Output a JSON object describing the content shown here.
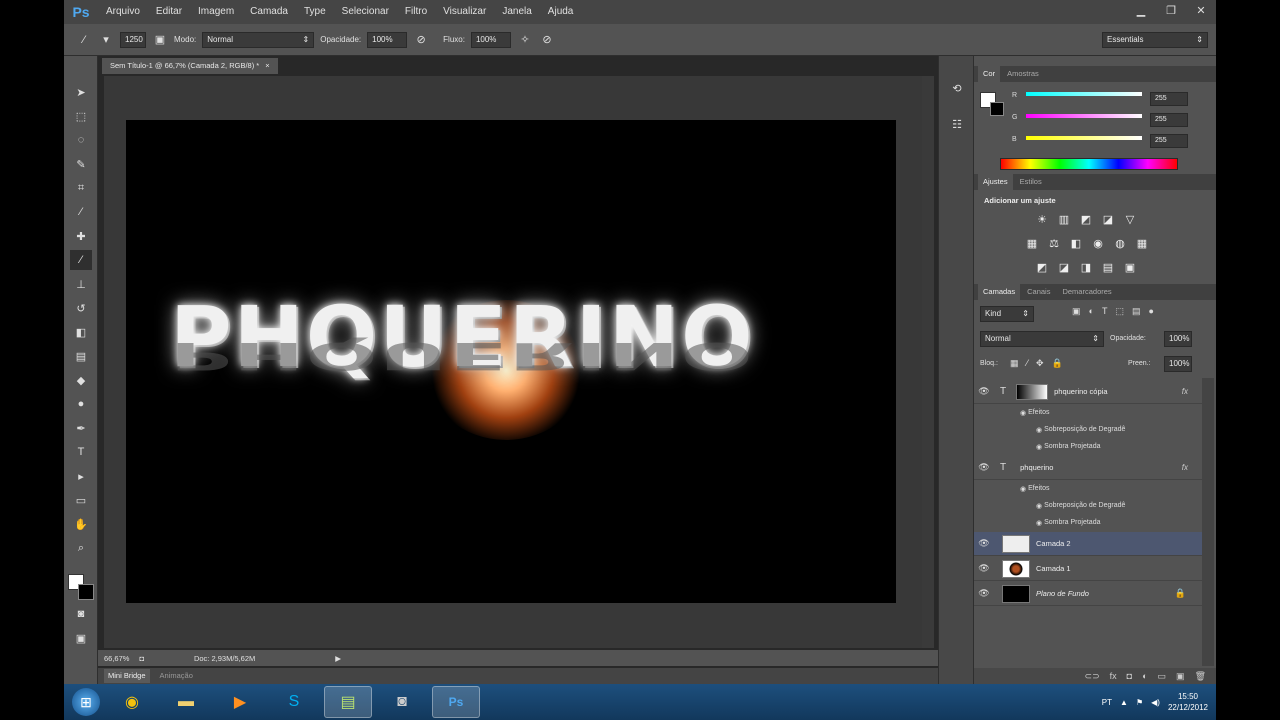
{
  "menubar": {
    "logo": "Ps",
    "items": [
      "Arquivo",
      "Editar",
      "Imagem",
      "Camada",
      "Type",
      "Selecionar",
      "Filtro",
      "Visualizar",
      "Janela",
      "Ajuda"
    ]
  },
  "options": {
    "brush_size": "1250",
    "mode_label": "Modo:",
    "mode_value": "Normal",
    "opacity_label": "Opacidade:",
    "opacity_value": "100%",
    "flow_label": "Fluxo:",
    "flow_value": "100%",
    "workspace": "Essentials"
  },
  "document": {
    "tab_title": "Sem Título-1 @ 66,7% (Camada 2, RGB/8) *",
    "logo_text": "PHQUERINO",
    "zoom": "66,67%",
    "doc_size": "Doc: 2,93M/5,62M"
  },
  "bottom_tabs": [
    "Mini Bridge",
    "Animação"
  ],
  "color_panel": {
    "tabs": [
      "Cor",
      "Amostras"
    ],
    "channels": [
      {
        "label": "R",
        "value": "255",
        "color": "#ff3030"
      },
      {
        "label": "G",
        "value": "255",
        "color": "#30ff30"
      },
      {
        "label": "B",
        "value": "255",
        "color": "#3030ff"
      }
    ]
  },
  "adjust_panel": {
    "tabs": [
      "Ajustes",
      "Estilos"
    ],
    "title": "Adicionar um ajuste"
  },
  "layers_panel": {
    "tabs": [
      "Camadas",
      "Canais",
      "Demarcadores"
    ],
    "kind": "Kind",
    "blend": "Normal",
    "opacity_label": "Opacidade:",
    "opacity_value": "100%",
    "lock_label": "Bloq.:",
    "fill_label": "Preen.:",
    "fill_value": "100%",
    "layers": [
      {
        "name": "phquerino cópia",
        "effects_label": "Efeitos",
        "effects": [
          "Sobreposição de Degradê",
          "Sombra Projetada"
        ]
      },
      {
        "name": "phquerino",
        "effects_label": "Efeitos",
        "effects": [
          "Sobreposição de Degradê",
          "Sombra Projetada"
        ]
      },
      {
        "name": "Camada 2"
      },
      {
        "name": "Camada 1"
      },
      {
        "name": "Plano de Fundo"
      }
    ]
  },
  "taskbar": {
    "lang": "PT",
    "time": "15:50",
    "date": "22/12/2012"
  }
}
